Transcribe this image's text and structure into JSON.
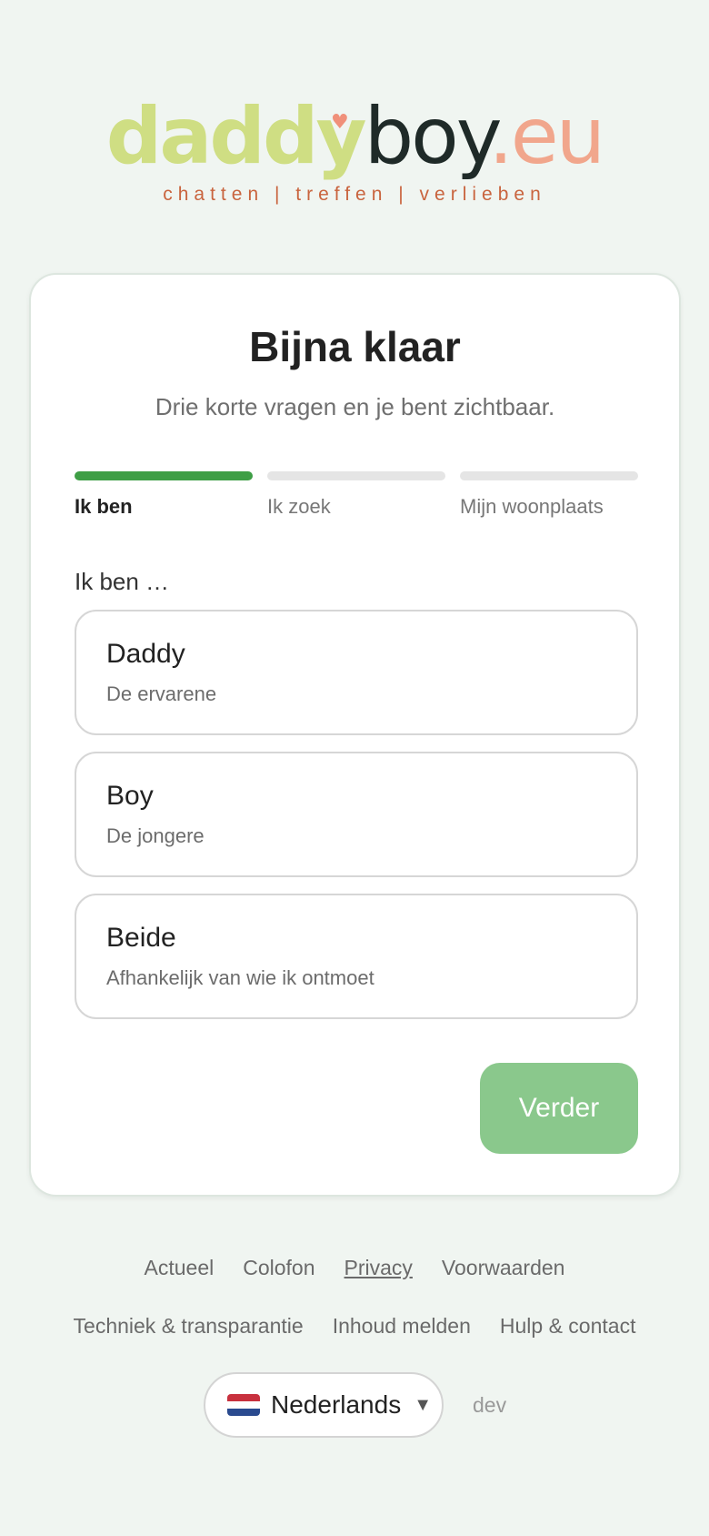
{
  "logo": {
    "part1": "daddy",
    "part2": "boy",
    "part3": ".eu",
    "tagline": "chatten | treffen | verlieben"
  },
  "card": {
    "title": "Bijna klaar",
    "subtitle": "Drie korte vragen en je bent zichtbaar.",
    "steps": [
      {
        "label": "Ik ben",
        "active": true
      },
      {
        "label": "Ik zoek",
        "active": false
      },
      {
        "label": "Mijn woonplaats",
        "active": false
      }
    ],
    "question": "Ik ben …",
    "options": [
      {
        "title": "Daddy",
        "description": "De ervarene"
      },
      {
        "title": "Boy",
        "description": "De jongere"
      },
      {
        "title": "Beide",
        "description": "Afhankelijk van wie ik ontmoet"
      }
    ],
    "next_label": "Verder"
  },
  "footer": {
    "row1": [
      "Actueel",
      "Colofon",
      "Privacy",
      "Voorwaarden"
    ],
    "row2": [
      "Techniek & transparantie",
      "Inhoud melden",
      "Hulp & contact"
    ],
    "language": "Nederlands",
    "env": "dev"
  },
  "colors": {
    "accent": "#3e9e45",
    "button": "#8ac88c",
    "logo_green": "#cfde83",
    "logo_peach": "#f1a68c",
    "tagline": "#c9643e"
  },
  "icons": {
    "flag": "flag-nl-icon",
    "caret": "caret-down-icon",
    "heart": "heart-icon"
  }
}
